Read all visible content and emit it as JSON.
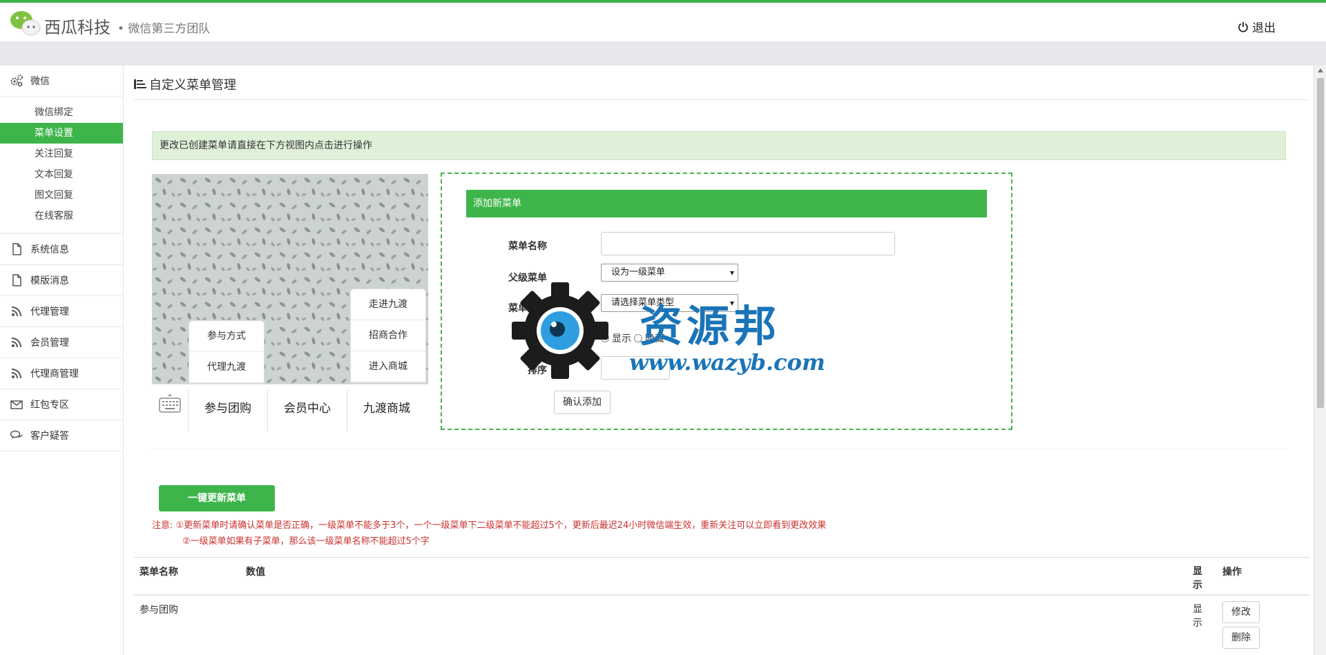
{
  "header": {
    "brand": "西瓜科技",
    "brand_sub": "• 微信第三方团队",
    "logout": "退出"
  },
  "sidebar": {
    "weixin": "微信",
    "weixin_items": [
      "微信绑定",
      "菜单设置",
      "关注回复",
      "文本回复",
      "图文回复",
      "在线客服"
    ],
    "groups": [
      {
        "label": "系统信息",
        "icon": "file-icon"
      },
      {
        "label": "模版消息",
        "icon": "file-icon"
      },
      {
        "label": "代理管理",
        "icon": "rss-icon"
      },
      {
        "label": "会员管理",
        "icon": "rss-icon"
      },
      {
        "label": "代理商管理",
        "icon": "rss-icon"
      },
      {
        "label": "红包专区",
        "icon": "envelope-icon"
      },
      {
        "label": "客户疑答",
        "icon": "comments-icon"
      }
    ]
  },
  "page": {
    "title": "自定义菜单管理",
    "notice": "更改已创建菜单请直接在下方视图内点击进行操作"
  },
  "phone": {
    "main_menu": [
      "参与团购",
      "会员中心",
      "九渡商城"
    ],
    "left_submenu": [
      "参与方式",
      "代理九渡"
    ],
    "right_submenu": [
      "走进九渡",
      "招商合作",
      "进入商城"
    ]
  },
  "form": {
    "header": "添加新菜单",
    "name_label": "菜单名称",
    "name_value": "",
    "parent_label": "父级菜单",
    "parent_value": "设为一级菜单",
    "type_label": "菜单类型",
    "type_value": "请选择菜单类型",
    "display_label": "显示",
    "show": "显示",
    "hide": "隐藏",
    "sort_label": "排序",
    "sort_value": "",
    "confirm": "确认添加"
  },
  "update_button": "一键更新菜单",
  "note": {
    "line1": "注意: ①更新菜单时请确认菜单是否正确，一级菜单不能多于3个，一个一级菜单下二级菜单不能超过5个，更新后最迟24小时微信端生效，重新关注可以立即看到更改效果",
    "line2": "②一级菜单如果有子菜单，那么该一级菜单名称不能超过5个字"
  },
  "table": {
    "headers": {
      "name": "菜单名称",
      "value": "数值",
      "display": "显示",
      "ops": "操作"
    },
    "rows": [
      {
        "name": "参与团购",
        "value": "",
        "display": "显示",
        "edit": "修改",
        "delete": "删除"
      }
    ]
  },
  "watermark": {
    "cn": "资源邦",
    "url": "www.wazyb.com"
  },
  "colors": {
    "accent": "#3db54a",
    "notice_bg": "#dff0d8",
    "note_red": "#c9302c",
    "watermark_blue": "#1a74b8"
  }
}
